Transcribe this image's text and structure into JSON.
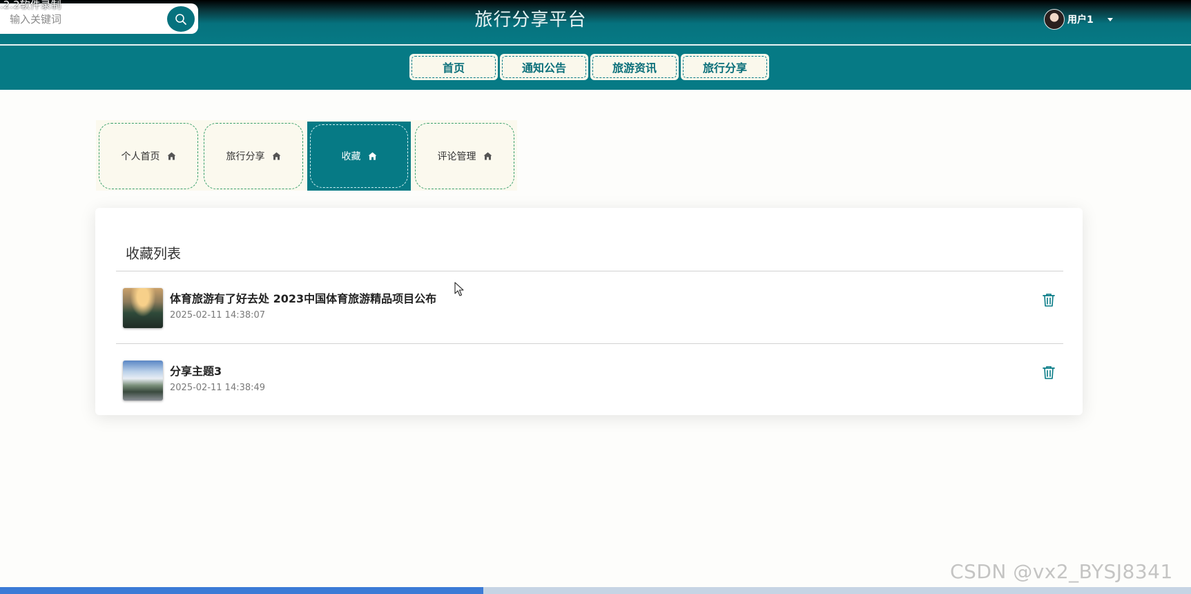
{
  "overlay": {
    "caption": ".2.2软件录制"
  },
  "header": {
    "site_title": "旅行分享平台",
    "search": {
      "placeholder": "输入关键词",
      "value": ""
    },
    "user": {
      "name": "用户1"
    }
  },
  "nav": {
    "items": [
      {
        "label": "首页"
      },
      {
        "label": "通知公告"
      },
      {
        "label": "旅游资讯"
      },
      {
        "label": "旅行分享"
      }
    ]
  },
  "tabs": {
    "items": [
      {
        "label": "个人首页",
        "active": false
      },
      {
        "label": "旅行分享",
        "active": false
      },
      {
        "label": "收藏",
        "active": true
      },
      {
        "label": "评论管理",
        "active": false
      }
    ]
  },
  "favorites": {
    "title": "收藏列表",
    "items": [
      {
        "title": "体育旅游有了好去处 2023中国体育旅游精品项目公布",
        "time": "2025-02-11 14:38:07"
      },
      {
        "title": "分享主题3",
        "time": "2025-02-11 14:38:49"
      }
    ]
  },
  "watermark": "CSDN @vx2_BYSJ8341",
  "colors": {
    "primary": "#067a85",
    "tab_background": "#fbf9ee",
    "tab_border": "#3aa06a",
    "nav_text": "#0a6f7a"
  },
  "icons": {
    "search": "search-icon",
    "home": "home-icon",
    "trash": "trash-icon",
    "caret": "caret-down-icon"
  }
}
